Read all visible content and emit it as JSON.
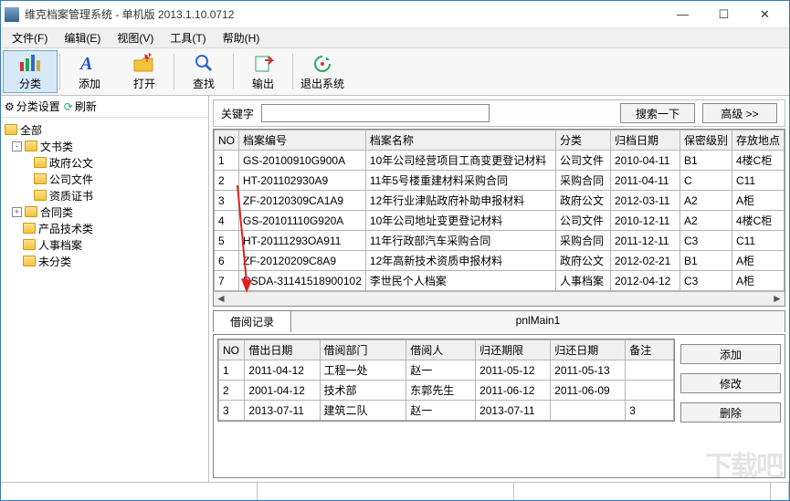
{
  "window": {
    "title": "维克档案管理系统 - 单机版 2013.1.10.0712"
  },
  "menu": {
    "file": "文件(F)",
    "edit": "编辑(E)",
    "view": "视图(V)",
    "tools": "工具(T)",
    "help": "帮助(H)"
  },
  "toolbar": {
    "classify": "分类",
    "add": "添加",
    "open": "打开",
    "find": "查找",
    "export": "输出",
    "exit": "退出系统"
  },
  "leftbar": {
    "settings": "分类设置",
    "refresh": "刷新"
  },
  "tree": {
    "root": "全部",
    "n1": "文书类",
    "n1a": "政府公文",
    "n1b": "公司文件",
    "n1c": "资质证书",
    "n2": "合同类",
    "n3": "产品技术类",
    "n4": "人事档案",
    "n5": "未分类"
  },
  "search": {
    "label": "关键字",
    "value": "",
    "go": "搜索一下",
    "adv": "高级  >>"
  },
  "grid1": {
    "h_no": "NO",
    "h_code": "档案编号",
    "h_name": "档案名称",
    "h_cat": "分类",
    "h_date": "归档日期",
    "h_sec": "保密级别",
    "h_loc": "存放地点",
    "rows": [
      {
        "no": "1",
        "code": "GS-20100910G900A",
        "name": "10年公司经营项目工商变更登记材料",
        "cat": "公司文件",
        "date": "2010-04-11",
        "sec": "B1",
        "loc": "4楼C柜"
      },
      {
        "no": "2",
        "code": "HT-201102930A9",
        "name": "11年5号楼重建材料采购合同",
        "cat": "采购合同",
        "date": "2011-04-11",
        "sec": "C",
        "loc": "C11"
      },
      {
        "no": "3",
        "code": "ZF-20120309CA1A9",
        "name": "12年行业津贴政府补助申报材料",
        "cat": "政府公文",
        "date": "2012-03-11",
        "sec": "A2",
        "loc": "A柜"
      },
      {
        "no": "4",
        "code": "GS-20101110G920A",
        "name": "10年公司地址变更登记材料",
        "cat": "公司文件",
        "date": "2010-12-11",
        "sec": "A2",
        "loc": "4楼C柜"
      },
      {
        "no": "5",
        "code": "HT-20111293OA911",
        "name": "11年行政部汽车采购合同",
        "cat": "采购合同",
        "date": "2011-12-11",
        "sec": "C3",
        "loc": "C11"
      },
      {
        "no": "6",
        "code": "ZF-20120209C8A9",
        "name": "12年高新技术资质申报材料",
        "cat": "政府公文",
        "date": "2012-02-21",
        "sec": "B1",
        "loc": "A柜"
      },
      {
        "no": "7",
        "code": "RSDA-31141518900102",
        "name": "李世民个人档案",
        "cat": "人事档案",
        "date": "2012-04-12",
        "sec": "C3",
        "loc": "A柜"
      }
    ]
  },
  "tabs": {
    "borrow": "借阅记录",
    "main": "pnlMain1"
  },
  "grid2": {
    "h_no": "NO",
    "h_out": "借出日期",
    "h_dept": "借阅部门",
    "h_person": "借阅人",
    "h_due": "归还期限",
    "h_ret": "归还日期",
    "h_note": "备注",
    "rows": [
      {
        "no": "1",
        "out": "2011-04-12",
        "dept": "工程一处",
        "person": "赵一",
        "due": "2011-05-12",
        "ret": "2011-05-13",
        "note": ""
      },
      {
        "no": "2",
        "out": "2001-04-12",
        "dept": "技术部",
        "person": "东郭先生",
        "due": "2011-06-12",
        "ret": "2011-06-09",
        "note": ""
      },
      {
        "no": "3",
        "out": "2013-07-11",
        "dept": "建筑二队",
        "person": "赵一",
        "due": "2013-07-11",
        "ret": "",
        "note": "3"
      }
    ]
  },
  "btns": {
    "add": "添加",
    "edit": "修改",
    "del": "删除"
  },
  "watermark": "下载吧"
}
